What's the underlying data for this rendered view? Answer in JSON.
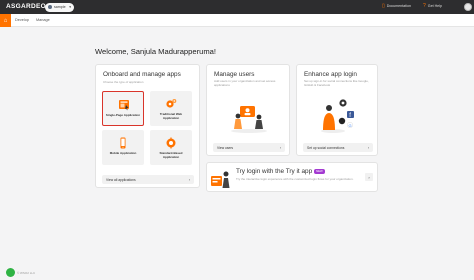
{
  "header": {
    "logo": "ASGARDEO",
    "org_name": "sample",
    "documentation": "Documentation",
    "help": "Get Help"
  },
  "subnav": {
    "develop": "Develop",
    "manage": "Manage"
  },
  "welcome": "Welcome, Sanjula Madurapperuma!",
  "onboard": {
    "title": "Onboard and manage apps",
    "desc": "Choose the type of application",
    "tiles": [
      {
        "label": "Single-Page Application",
        "icon": "single-page-app-icon"
      },
      {
        "label": "Traditional Web Application",
        "icon": "gears-icon"
      },
      {
        "label": "Mobile Application",
        "icon": "mobile-app-icon"
      },
      {
        "label": "Standard-Based Application",
        "icon": "standard-app-icon"
      }
    ],
    "footer": "View all applications"
  },
  "manage_users": {
    "title": "Manage users",
    "desc": "Add users in your organization and set access applications",
    "footer": "View users"
  },
  "app_login": {
    "title": "Enhance app login",
    "desc": "Set up sign-in for social connections like Google, GitHub & Facebook",
    "footer": "Set up social connections"
  },
  "tryit": {
    "title": "Try login with the Try it app",
    "badge": "NEW",
    "desc": "Try the interactive login experience with the customized login flows for your organization."
  },
  "footer": {
    "copyright": "© WSO2 LLC"
  },
  "colors": {
    "accent": "#ff7300",
    "selected_border": "#d9352b",
    "topbar": "#2d2d2f"
  }
}
